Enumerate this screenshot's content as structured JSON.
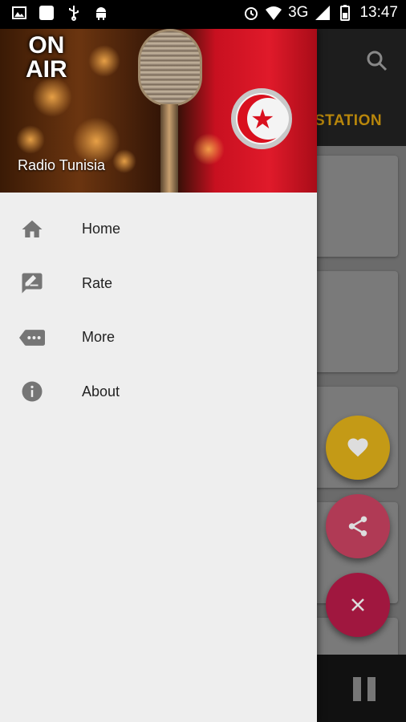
{
  "status_bar": {
    "network": "3G",
    "time": "13:47",
    "icons": [
      "image-icon",
      "app-icon",
      "usb-icon",
      "android-icon",
      "alarm-icon",
      "wifi-icon",
      "signal-icon",
      "battery-icon"
    ]
  },
  "background_app": {
    "tab_label": "STATION",
    "toolbar_color": "#1d1d1d",
    "accent_color": "#b8860b",
    "fabs": [
      {
        "name": "favorite",
        "color": "#c49a16",
        "icon": "heart-icon"
      },
      {
        "name": "share",
        "color": "#b03a55",
        "icon": "share-icon"
      },
      {
        "name": "close",
        "color": "#a0173f",
        "icon": "close-icon"
      }
    ]
  },
  "drawer": {
    "header": {
      "badge_line1": "ON",
      "badge_line2": "AIR",
      "title": "Radio Tunisia"
    },
    "items": [
      {
        "label": "Home",
        "icon": "home-icon"
      },
      {
        "label": "Rate",
        "icon": "rate-icon"
      },
      {
        "label": "More",
        "icon": "more-icon"
      },
      {
        "label": "About",
        "icon": "info-icon"
      }
    ],
    "icon_color": "#757575"
  }
}
